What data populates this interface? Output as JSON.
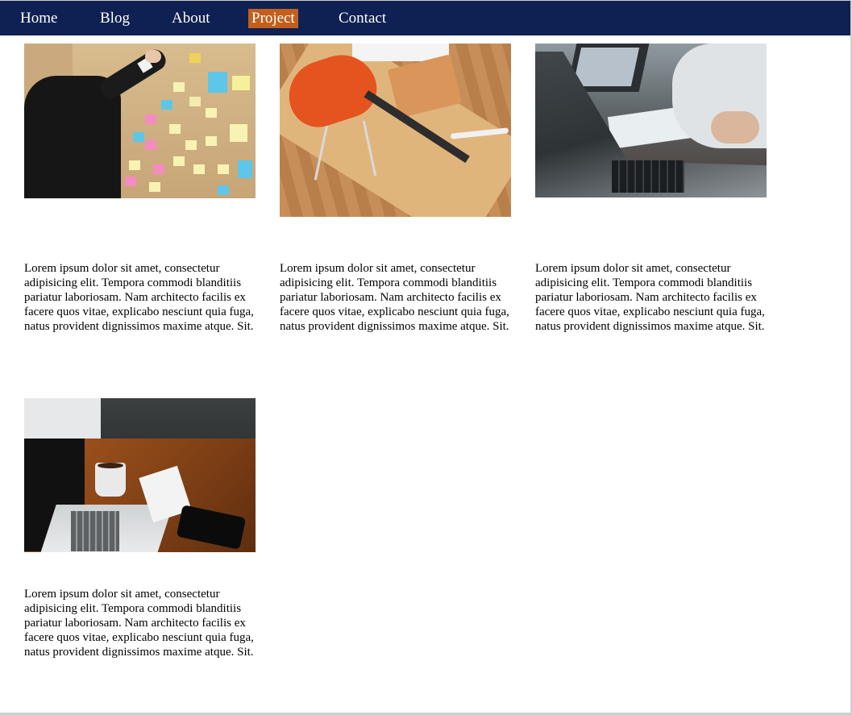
{
  "nav": {
    "items": [
      {
        "label": "Home"
      },
      {
        "label": "Blog"
      },
      {
        "label": "About"
      },
      {
        "label": "Project",
        "active": true
      },
      {
        "label": "Contact"
      }
    ],
    "background_color": "#0f2152",
    "active_color": "#c25f1c"
  },
  "projects": {
    "items": [
      {
        "image": "sticky-notes-board-photo",
        "text": "Lorem ipsum dolor sit amet, consectetur adipisicing elit. Tempora commodi blanditiis pariatur laboriosam. Nam architecto facilis ex facere quos vitae, explicabo nesciunt quia fuga, natus provident dignissimos maxime atque. Sit."
      },
      {
        "image": "desk-orange-chair-photo",
        "text": "Lorem ipsum dolor sit amet, consectetur adipisicing elit. Tempora commodi blanditiis pariatur laboriosam. Nam architecto facilis ex facere quos vitae, explicabo nesciunt quia fuga, natus provident dignissimos maxime atque. Sit."
      },
      {
        "image": "laptop-meeting-photo",
        "text": "Lorem ipsum dolor sit amet, consectetur adipisicing elit. Tempora commodi blanditiis pariatur laboriosam. Nam architecto facilis ex facere quos vitae, explicabo nesciunt quia fuga, natus provident dignissimos maxime atque. Sit."
      },
      {
        "image": "laptop-coffee-desk-photo",
        "text": "Lorem ipsum dolor sit amet, consectetur adipisicing elit. Tempora commodi blanditiis pariatur laboriosam. Nam architecto facilis ex facere quos vitae, explicabo nesciunt quia fuga, natus provident dignissimos maxime atque. Sit."
      }
    ]
  }
}
